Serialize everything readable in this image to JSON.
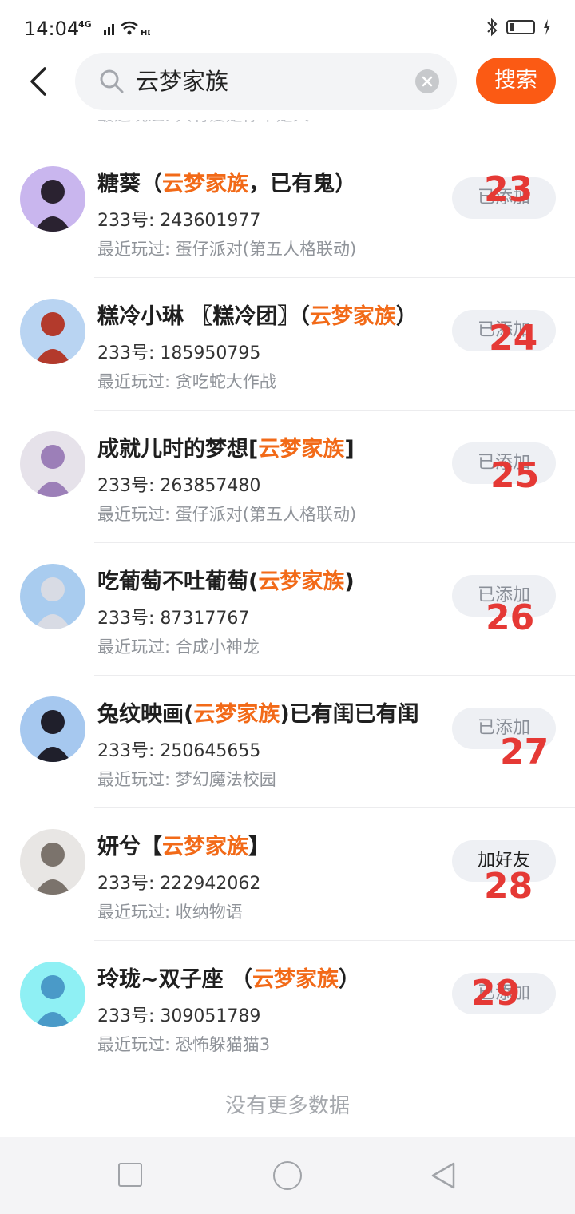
{
  "status_bar": {
    "time": "14:04",
    "network": "4G"
  },
  "search": {
    "query": "云梦家族",
    "button_label": "搜索"
  },
  "partial_row": {
    "text": "最近玩过: 只有爱是你不是人"
  },
  "results": [
    {
      "name_pre": "糖葵（",
      "name_hl": "云梦家族",
      "name_post": "，已有鬼）",
      "uid": "233号: 243601977",
      "played": "最近玩过: 蛋仔派对(第五人格联动)",
      "button": "已添加",
      "annotation": "23",
      "avatar_color": "#c9b6ee",
      "avatar_fig": "#2a2230"
    },
    {
      "name_pre": "糕冷小琳 〖糕冷团〗（",
      "name_hl": "云梦家族",
      "name_post": "）",
      "uid": "233号: 185950795",
      "played": "最近玩过: 贪吃蛇大作战",
      "button": "已添加",
      "annotation": "24",
      "avatar_color": "#b9d4f2",
      "avatar_fig": "#b33a2c"
    },
    {
      "name_pre": "成就儿时的梦想[",
      "name_hl": "云梦家族",
      "name_post": "]",
      "uid": "233号: 263857480",
      "played": "最近玩过: 蛋仔派对(第五人格联动)",
      "button": "已添加",
      "annotation": "25",
      "avatar_color": "#e6e2ea",
      "avatar_fig": "#9c7fb8"
    },
    {
      "name_pre": "吃葡萄不吐葡萄(",
      "name_hl": "云梦家族",
      "name_post": ")",
      "uid": "233号: 87317767",
      "played": "最近玩过: 合成小神龙",
      "button": "已添加",
      "annotation": "26",
      "avatar_color": "#a9ccef",
      "avatar_fig": "#d8dbe4"
    },
    {
      "name_pre": "兔纹映画(",
      "name_hl": "云梦家族",
      "name_post": ")已有闺已有闺",
      "uid": "233号: 250645655",
      "played": "最近玩过: 梦幻魔法校园",
      "button": "已添加",
      "annotation": "27",
      "avatar_color": "#a6c8ef",
      "avatar_fig": "#1f1f2b"
    },
    {
      "name_pre": "妍兮【",
      "name_hl": "云梦家族",
      "name_post": "】",
      "uid": "233号: 222942062",
      "played": "最近玩过: 收纳物语",
      "button": "加好友",
      "annotation": "28",
      "avatar_color": "#e8e6e4",
      "avatar_fig": "#7b736c"
    },
    {
      "name_pre": "玲珑~双子座 （",
      "name_hl": "云梦家族",
      "name_post": "）",
      "uid": "233号: 309051789",
      "played": "最近玩过: 恐怖躲猫猫3",
      "button": "已添加",
      "annotation": "29",
      "avatar_color": "#8ff0f4",
      "avatar_fig": "#4a9ac8"
    }
  ],
  "footer": {
    "no_more": "没有更多数据"
  },
  "colors": {
    "accent": "#fb5a14",
    "highlight": "#f26a18",
    "annotation": "#e53935"
  },
  "icons": {
    "back": "chevron-left-icon",
    "search": "search-icon",
    "clear": "clear-icon",
    "bluetooth": "bluetooth-icon",
    "battery": "battery-icon"
  }
}
